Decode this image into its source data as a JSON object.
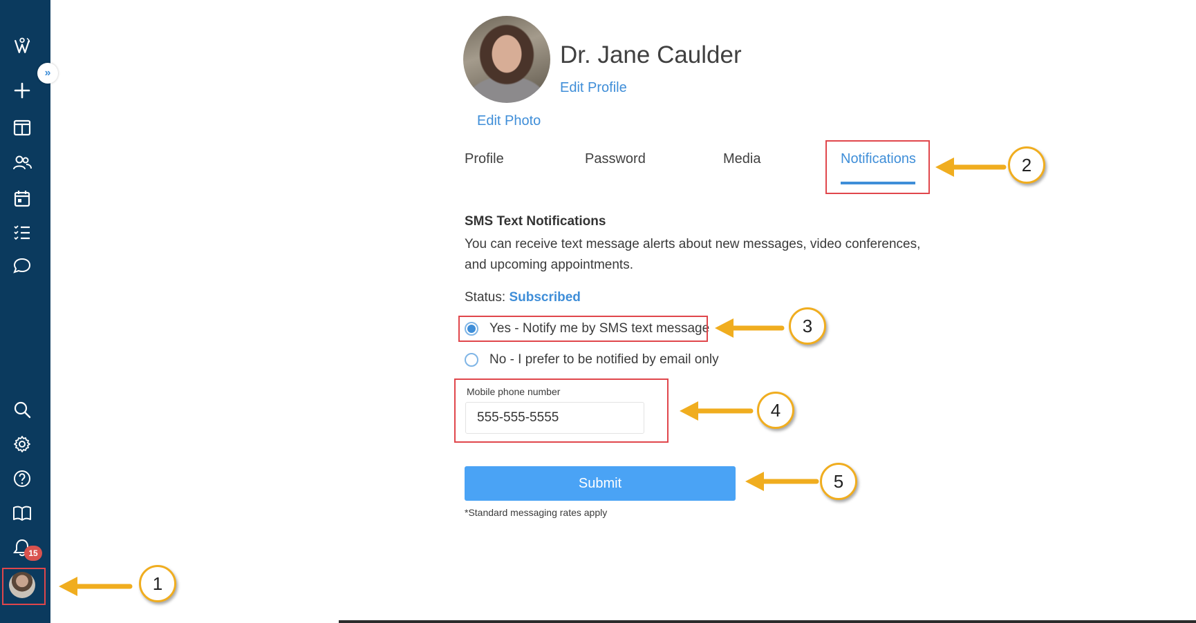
{
  "sidebar": {
    "expand_glyph": "»",
    "notification_count": "15",
    "icons": [
      "logo-icon",
      "plus-icon",
      "columns-icon",
      "users-icon",
      "calendar-icon",
      "checklist-icon",
      "chat-icon",
      "search-icon",
      "gear-icon",
      "help-icon",
      "book-icon",
      "bell-icon"
    ]
  },
  "profile": {
    "name": "Dr. Jane Caulder",
    "edit_profile": "Edit Profile",
    "edit_photo": "Edit Photo"
  },
  "tabs": [
    {
      "label": "Profile"
    },
    {
      "label": "Password"
    },
    {
      "label": "Media"
    },
    {
      "label": "Notifications",
      "active": true
    }
  ],
  "sms": {
    "title": "SMS Text Notifications",
    "description": "You can receive text message alerts about new messages, video conferences, and upcoming appointments.",
    "status_label": "Status:",
    "status_value": "Subscribed",
    "option_yes": "Yes - Notify me by SMS text message",
    "option_no": "No - I prefer to be notified by email only",
    "selected": "yes",
    "phone_label": "Mobile phone number",
    "phone_value": "555-555-5555",
    "submit_label": "Submit",
    "fine_print": "*Standard messaging rates apply"
  },
  "callouts": [
    "1",
    "2",
    "3",
    "4",
    "5"
  ],
  "colors": {
    "sidebar": "#0b3a5e",
    "accent": "#3f8ed8",
    "button": "#4aa3f5",
    "highlight": "#e0464b",
    "arrow": "#f0ad1f"
  }
}
